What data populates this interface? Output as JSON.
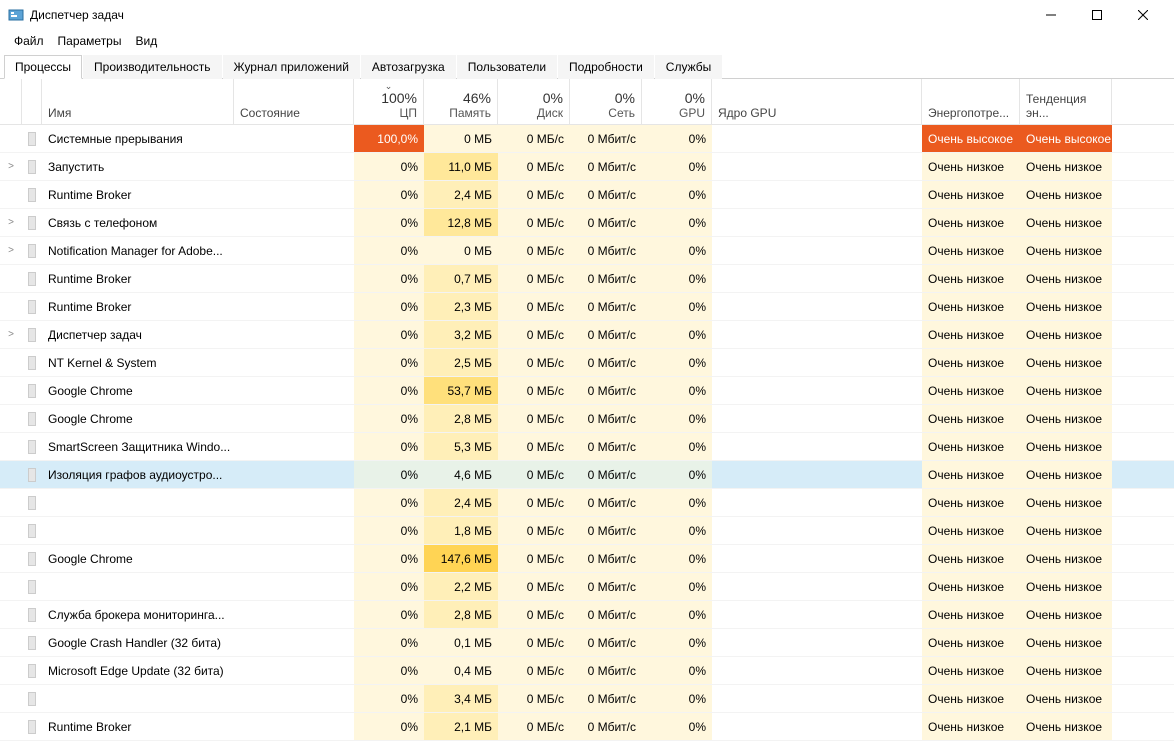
{
  "window": {
    "title": "Диспетчер задач"
  },
  "menu": {
    "file": "Файл",
    "options": "Параметры",
    "view": "Вид"
  },
  "tabs": {
    "processes": "Процессы",
    "performance": "Производительность",
    "app_history": "Журнал приложений",
    "startup": "Автозагрузка",
    "users": "Пользователи",
    "details": "Подробности",
    "services": "Службы"
  },
  "columns": {
    "name": "Имя",
    "status": "Состояние",
    "cpu": {
      "summary": "100%",
      "label": "ЦП"
    },
    "memory": {
      "summary": "46%",
      "label": "Память"
    },
    "disk": {
      "summary": "0%",
      "label": "Диск"
    },
    "network": {
      "summary": "0%",
      "label": "Сеть"
    },
    "gpu": {
      "summary": "0%",
      "label": "GPU"
    },
    "gpu_core": "Ядро GPU",
    "power": "Энергопотре...",
    "power_trend": "Тенденция эн..."
  },
  "sort_indicator": "⌄",
  "power_low": "Очень низкое",
  "power_high": "Очень высокое",
  "rows": [
    {
      "exp": "",
      "name": "Системные прерывания",
      "cpu": "100,0%",
      "cpu_cls": "heat-max",
      "mem": "0 МБ",
      "mem_cls": "heat-mem0",
      "disk": "0 МБ/с",
      "net": "0 Мбит/с",
      "gpu": "0%",
      "power": "high",
      "trend": "high",
      "sel": false
    },
    {
      "exp": ">",
      "name": "Запустить",
      "cpu": "0%",
      "cpu_cls": "heat-base",
      "mem": "11,0 МБ",
      "mem_cls": "heat-mem2",
      "disk": "0 МБ/с",
      "net": "0 Мбит/с",
      "gpu": "0%",
      "power": "low",
      "trend": "low",
      "sel": false
    },
    {
      "exp": "",
      "name": "Runtime Broker",
      "cpu": "0%",
      "cpu_cls": "heat-base",
      "mem": "2,4 МБ",
      "mem_cls": "heat-mem1",
      "disk": "0 МБ/с",
      "net": "0 Мбит/с",
      "gpu": "0%",
      "power": "low",
      "trend": "low",
      "sel": false
    },
    {
      "exp": ">",
      "name": "Связь с телефоном",
      "cpu": "0%",
      "cpu_cls": "heat-base",
      "mem": "12,8 МБ",
      "mem_cls": "heat-mem2",
      "disk": "0 МБ/с",
      "net": "0 Мбит/с",
      "gpu": "0%",
      "power": "low",
      "trend": "low",
      "sel": false
    },
    {
      "exp": ">",
      "name": "Notification Manager for Adobe...",
      "cpu": "0%",
      "cpu_cls": "heat-base",
      "mem": "0 МБ",
      "mem_cls": "heat-mem0",
      "disk": "0 МБ/с",
      "net": "0 Мбит/с",
      "gpu": "0%",
      "power": "low",
      "trend": "low",
      "sel": false
    },
    {
      "exp": "",
      "name": "Runtime Broker",
      "cpu": "0%",
      "cpu_cls": "heat-base",
      "mem": "0,7 МБ",
      "mem_cls": "heat-mem1",
      "disk": "0 МБ/с",
      "net": "0 Мбит/с",
      "gpu": "0%",
      "power": "low",
      "trend": "low",
      "sel": false
    },
    {
      "exp": "",
      "name": "Runtime Broker",
      "cpu": "0%",
      "cpu_cls": "heat-base",
      "mem": "2,3 МБ",
      "mem_cls": "heat-mem1",
      "disk": "0 МБ/с",
      "net": "0 Мбит/с",
      "gpu": "0%",
      "power": "low",
      "trend": "low",
      "sel": false
    },
    {
      "exp": ">",
      "name": "Диспетчер задач",
      "cpu": "0%",
      "cpu_cls": "heat-base",
      "mem": "3,2 МБ",
      "mem_cls": "heat-mem1",
      "disk": "0 МБ/с",
      "net": "0 Мбит/с",
      "gpu": "0%",
      "power": "low",
      "trend": "low",
      "sel": false
    },
    {
      "exp": "",
      "name": "NT Kernel & System",
      "cpu": "0%",
      "cpu_cls": "heat-base",
      "mem": "2,5 МБ",
      "mem_cls": "heat-mem1",
      "disk": "0 МБ/с",
      "net": "0 Мбит/с",
      "gpu": "0%",
      "power": "low",
      "trend": "low",
      "sel": false
    },
    {
      "exp": "",
      "name": "Google Chrome",
      "cpu": "0%",
      "cpu_cls": "heat-base",
      "mem": "53,7 МБ",
      "mem_cls": "heat-mem3",
      "disk": "0 МБ/с",
      "net": "0 Мбит/с",
      "gpu": "0%",
      "power": "low",
      "trend": "low",
      "sel": false
    },
    {
      "exp": "",
      "name": "Google Chrome",
      "cpu": "0%",
      "cpu_cls": "heat-base",
      "mem": "2,8 МБ",
      "mem_cls": "heat-mem1",
      "disk": "0 МБ/с",
      "net": "0 Мбит/с",
      "gpu": "0%",
      "power": "low",
      "trend": "low",
      "sel": false
    },
    {
      "exp": "",
      "name": "SmartScreen Защитника Windo...",
      "cpu": "0%",
      "cpu_cls": "heat-base",
      "mem": "5,3 МБ",
      "mem_cls": "heat-mem1",
      "disk": "0 МБ/с",
      "net": "0 Мбит/с",
      "gpu": "0%",
      "power": "low",
      "trend": "low",
      "sel": false
    },
    {
      "exp": "",
      "name": "Изоляция графов аудиоустро...",
      "cpu": "0%",
      "cpu_cls": "heat-base",
      "mem": "4,6 МБ",
      "mem_cls": "heat-mem1",
      "disk": "0 МБ/с",
      "net": "0 Мбит/с",
      "gpu": "0%",
      "power": "low",
      "trend": "low",
      "sel": true
    },
    {
      "exp": "",
      "name": "",
      "cpu": "0%",
      "cpu_cls": "heat-base",
      "mem": "2,4 МБ",
      "mem_cls": "heat-mem1",
      "disk": "0 МБ/с",
      "net": "0 Мбит/с",
      "gpu": "0%",
      "power": "low",
      "trend": "low",
      "sel": false
    },
    {
      "exp": "",
      "name": "",
      "cpu": "0%",
      "cpu_cls": "heat-base",
      "mem": "1,8 МБ",
      "mem_cls": "heat-mem1",
      "disk": "0 МБ/с",
      "net": "0 Мбит/с",
      "gpu": "0%",
      "power": "low",
      "trend": "low",
      "sel": false
    },
    {
      "exp": "",
      "name": "Google Chrome",
      "cpu": "0%",
      "cpu_cls": "heat-base",
      "mem": "147,6 МБ",
      "mem_cls": "heat-mem4",
      "disk": "0 МБ/с",
      "net": "0 Мбит/с",
      "gpu": "0%",
      "power": "low",
      "trend": "low",
      "sel": false
    },
    {
      "exp": "",
      "name": "",
      "cpu": "0%",
      "cpu_cls": "heat-base",
      "mem": "2,2 МБ",
      "mem_cls": "heat-mem1",
      "disk": "0 МБ/с",
      "net": "0 Мбит/с",
      "gpu": "0%",
      "power": "low",
      "trend": "low",
      "sel": false
    },
    {
      "exp": "",
      "name": "Служба брокера мониторинга...",
      "cpu": "0%",
      "cpu_cls": "heat-base",
      "mem": "2,8 МБ",
      "mem_cls": "heat-mem1",
      "disk": "0 МБ/с",
      "net": "0 Мбит/с",
      "gpu": "0%",
      "power": "low",
      "trend": "low",
      "sel": false
    },
    {
      "exp": "",
      "name": "Google Crash Handler (32 бита)",
      "cpu": "0%",
      "cpu_cls": "heat-base",
      "mem": "0,1 МБ",
      "mem_cls": "heat-mem0",
      "disk": "0 МБ/с",
      "net": "0 Мбит/с",
      "gpu": "0%",
      "power": "low",
      "trend": "low",
      "sel": false
    },
    {
      "exp": "",
      "name": "Microsoft Edge Update (32 бита)",
      "cpu": "0%",
      "cpu_cls": "heat-base",
      "mem": "0,4 МБ",
      "mem_cls": "heat-mem0",
      "disk": "0 МБ/с",
      "net": "0 Мбит/с",
      "gpu": "0%",
      "power": "low",
      "trend": "low",
      "sel": false
    },
    {
      "exp": "",
      "name": "",
      "cpu": "0%",
      "cpu_cls": "heat-base",
      "mem": "3,4 МБ",
      "mem_cls": "heat-mem1",
      "disk": "0 МБ/с",
      "net": "0 Мбит/с",
      "gpu": "0%",
      "power": "low",
      "trend": "low",
      "sel": false
    },
    {
      "exp": "",
      "name": "Runtime Broker",
      "cpu": "0%",
      "cpu_cls": "heat-base",
      "mem": "2,1 МБ",
      "mem_cls": "heat-mem1",
      "disk": "0 МБ/с",
      "net": "0 Мбит/с",
      "gpu": "0%",
      "power": "low",
      "trend": "low",
      "sel": false
    }
  ]
}
